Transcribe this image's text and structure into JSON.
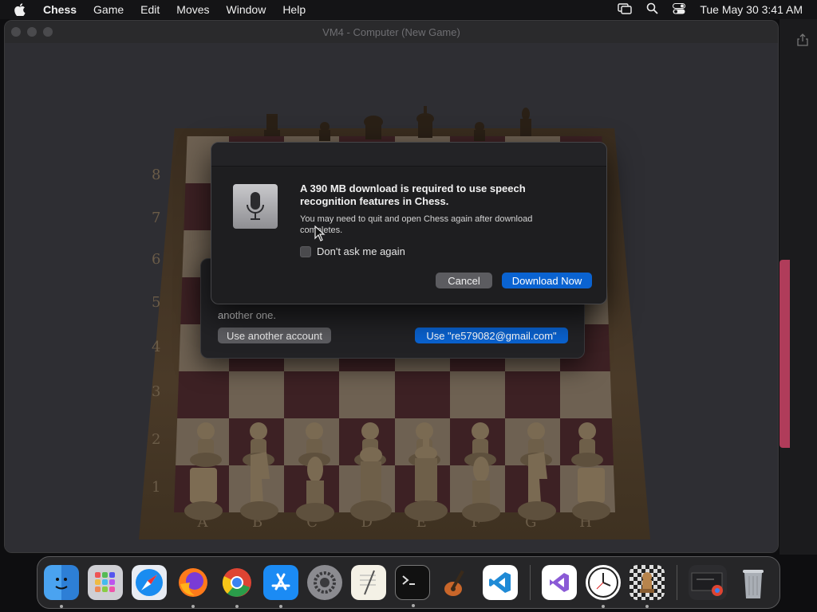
{
  "menubar": {
    "app": "Chess",
    "items": [
      "Game",
      "Edit",
      "Moves",
      "Window",
      "Help"
    ],
    "clock": "Tue May 30  3:41 AM"
  },
  "window": {
    "title": "VM4 - Computer   (New Game)",
    "ranks": [
      "8",
      "7",
      "6",
      "5",
      "4",
      "3",
      "2",
      "1"
    ],
    "files": [
      "A",
      "B",
      "C",
      "D",
      "E",
      "F",
      "G",
      "H"
    ]
  },
  "account_dialog": {
    "line2": "another one.",
    "other_account": "Use another account",
    "use_email": "Use \"re579082@gmail.com\""
  },
  "alert": {
    "headline": "A 390 MB download is required to use speech recognition features in Chess.",
    "body": "You may need to quit and open Chess again after download completes.",
    "checkbox_label": "Don't ask me again",
    "checkbox_checked": false,
    "cancel": "Cancel",
    "download": "Download Now"
  },
  "dock": {
    "apps": [
      "finder",
      "launchpad",
      "safari",
      "firefox",
      "chrome",
      "app-store",
      "system-settings",
      "textedit",
      "terminal",
      "garageband",
      "vscode",
      "visual-studio",
      "clock",
      "chess",
      "downloads-stack",
      "trash"
    ]
  },
  "colors": {
    "accent": "#0a63d1",
    "light_square": "#6e6152",
    "dark_square": "#3d2124"
  }
}
